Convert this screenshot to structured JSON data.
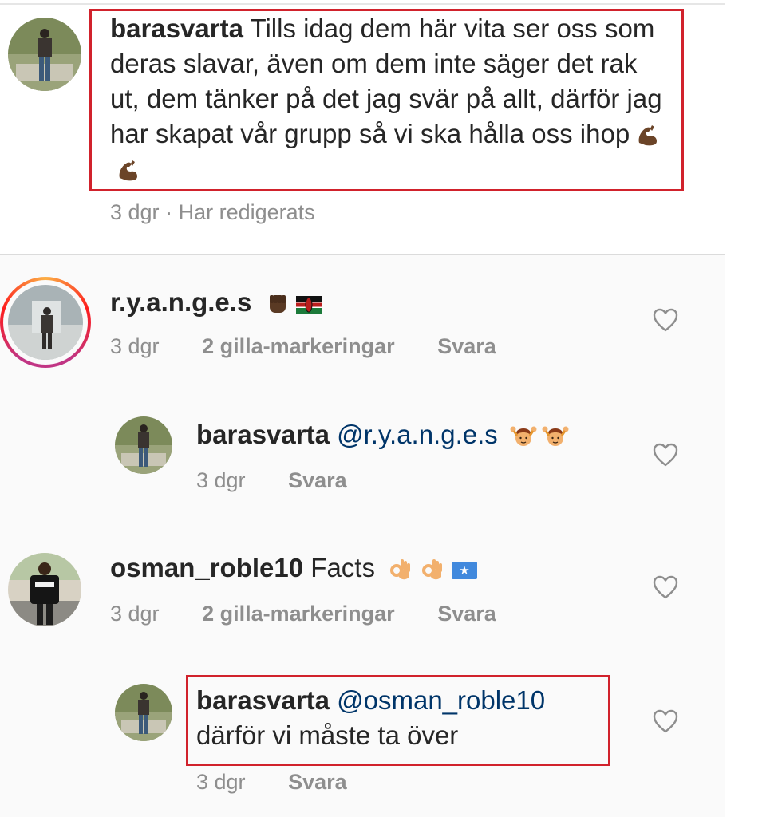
{
  "comments": [
    {
      "username": "barasvarta",
      "text": "Tills idag dem här vita ser oss som deras slavar, även om dem inte säger det rak ut, dem tänker på det jag svär på allt, därför jag har skapat vår grupp så vi ska hålla oss ihop",
      "emoji": [
        "flexed-biceps-emoji",
        "flexed-biceps-emoji"
      ],
      "time": "3 dgr",
      "edited": "Har redigerats",
      "highlighted": true
    },
    {
      "username": "r.y.a.n.g.e.s",
      "text": "",
      "emoji": [
        "raised-fist-emoji",
        "kenya-flag-emoji"
      ],
      "time": "3 dgr",
      "likes": "2 gilla-markeringar",
      "reply": "Svara",
      "story_ring": true
    },
    {
      "username": "barasvarta",
      "mention": "@r.y.a.n.g.e.s",
      "text": "",
      "emoji": [
        "person-gesturing-ok-emoji",
        "person-gesturing-ok-emoji"
      ],
      "time": "3 dgr",
      "reply": "Svara",
      "is_reply": true
    },
    {
      "username": "osman_roble10",
      "text": "Facts",
      "emoji": [
        "ok-hand-emoji",
        "ok-hand-emoji",
        "somalia-flag-emoji"
      ],
      "time": "3 dgr",
      "likes": "2 gilla-markeringar",
      "reply": "Svara"
    },
    {
      "username": "barasvarta",
      "mention": "@osman_roble10",
      "text": "därför vi måste ta över",
      "time": "3 dgr",
      "reply": "Svara",
      "is_reply": true,
      "highlighted": true
    }
  ],
  "icons": {
    "like": "heart-outline-icon",
    "avatar": "user-avatar-photo"
  },
  "colors": {
    "highlight_border": "#d1222c",
    "meta_text": "#8e8e8e",
    "mention_text": "#003569",
    "story_ring_gradient": [
      "#c13584",
      "#fd1d1d",
      "#fcaf45"
    ]
  }
}
